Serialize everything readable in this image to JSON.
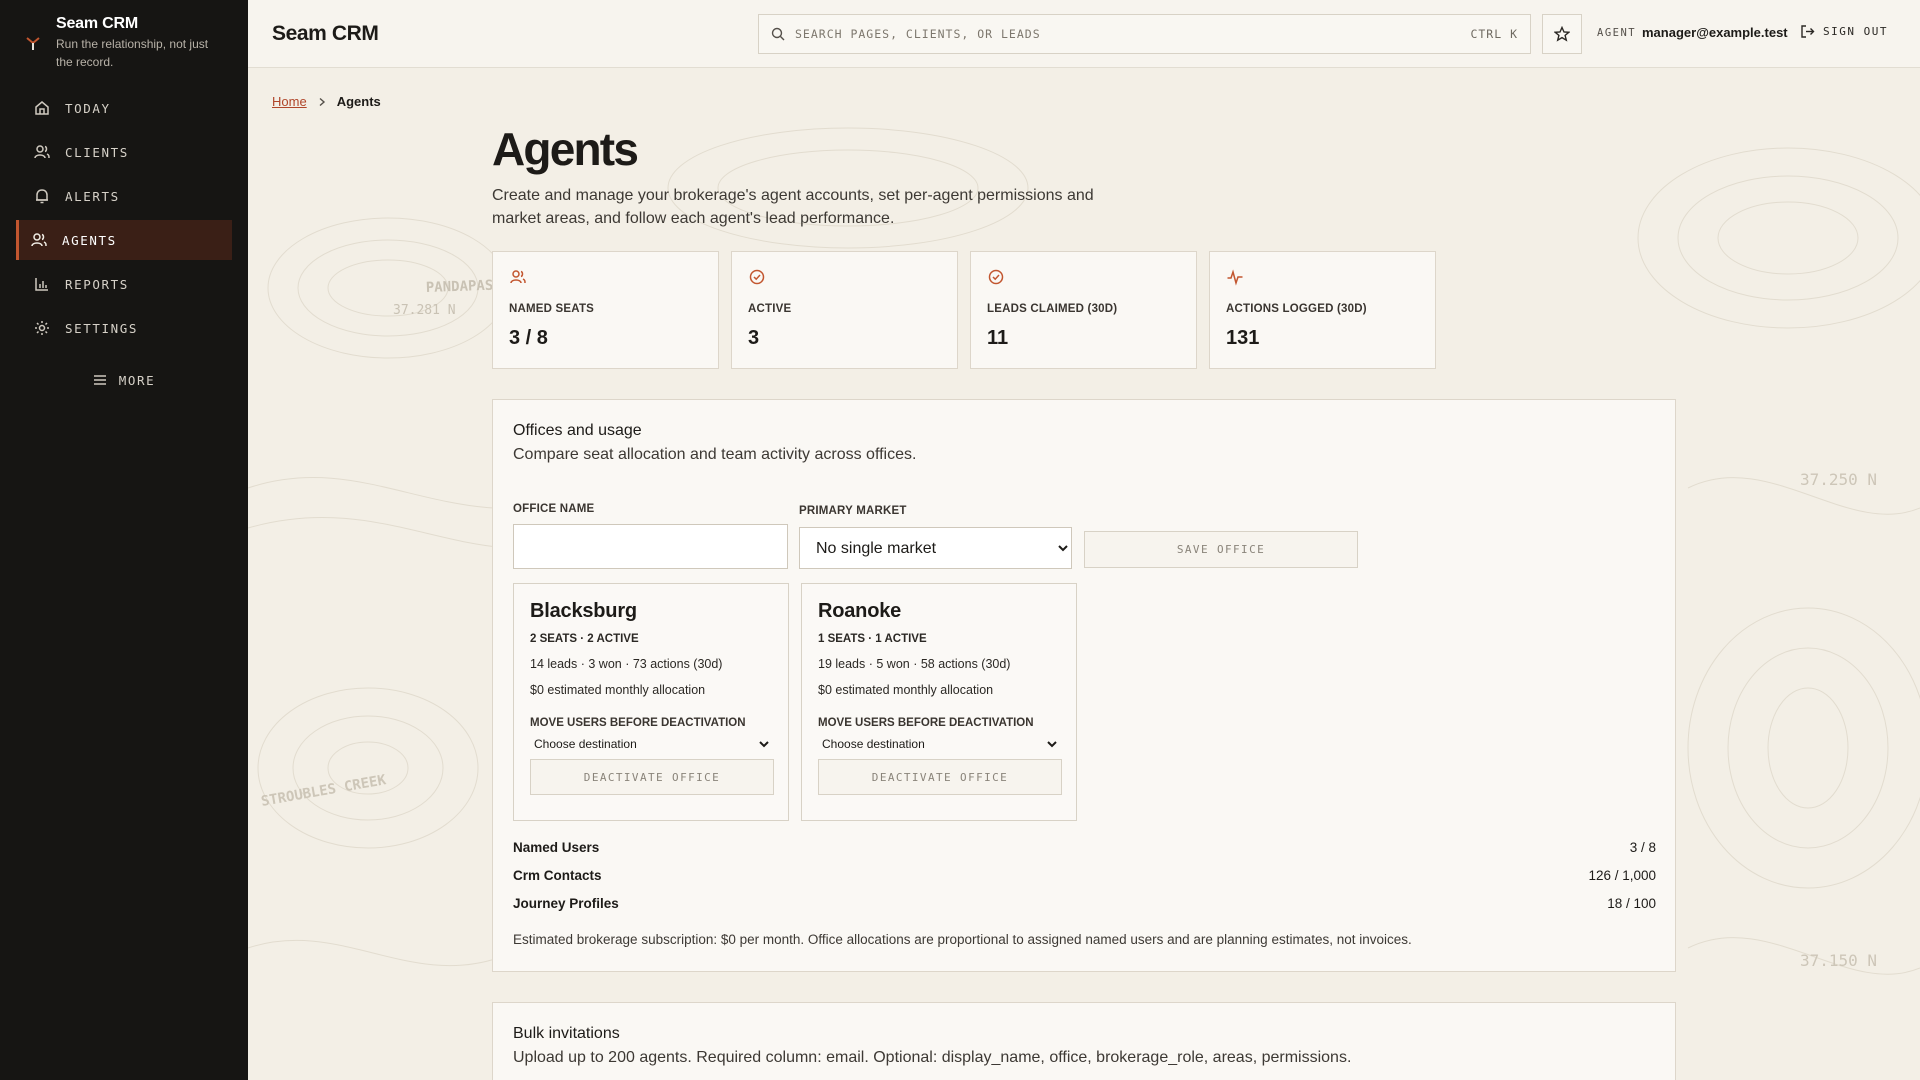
{
  "app": {
    "name": "Seam CRM",
    "tagline": "Run the relationship, not just the record.",
    "accent": "#c2562f"
  },
  "sidebar": {
    "items": [
      {
        "label": "TODAY",
        "icon": "home-icon"
      },
      {
        "label": "CLIENTS",
        "icon": "users-icon"
      },
      {
        "label": "ALERTS",
        "icon": "bell-icon"
      },
      {
        "label": "AGENTS",
        "icon": "users-icon",
        "active": true
      },
      {
        "label": "REPORTS",
        "icon": "bar-chart-icon"
      },
      {
        "label": "SETTINGS",
        "icon": "gear-icon"
      }
    ],
    "more_label": "MORE"
  },
  "topbar": {
    "title": "Seam CRM",
    "search_placeholder": "SEARCH PAGES, CLIENTS, OR LEADS",
    "search_shortcut": "CTRL K",
    "agent_label": "AGENT",
    "agent_email": "manager@example.test",
    "signout_label": "SIGN OUT"
  },
  "breadcrumb": {
    "home": "Home",
    "current": "Agents"
  },
  "page": {
    "title": "Agents",
    "description": "Create and manage your brokerage's agent accounts, set per-agent permissions and market areas, and follow each agent's lead performance."
  },
  "stats": [
    {
      "label": "NAMED SEATS",
      "value": "3 / 8",
      "icon": "users-icon"
    },
    {
      "label": "ACTIVE",
      "value": "3",
      "icon": "check-circle-icon"
    },
    {
      "label": "LEADS CLAIMED (30D)",
      "value": "11",
      "icon": "check-circle-icon"
    },
    {
      "label": "ACTIONS LOGGED (30D)",
      "value": "131",
      "icon": "activity-icon"
    }
  ],
  "offices_panel": {
    "title": "Offices and usage",
    "subtitle": "Compare seat allocation and team activity across offices.",
    "office_name_label": "OFFICE NAME",
    "office_name_value": "",
    "primary_market_label": "PRIMARY MARKET",
    "primary_market_value": "No single market",
    "save_label": "SAVE OFFICE",
    "offices": [
      {
        "name": "Blacksburg",
        "seats": "2 SEATS · 2 ACTIVE",
        "activity": "14 leads · 3 won · 73 actions (30d)",
        "allocation": "$0 estimated monthly allocation",
        "move_label": "MOVE USERS BEFORE DEACTIVATION",
        "destination": "Choose destination",
        "deactivate_label": "DEACTIVATE OFFICE"
      },
      {
        "name": "Roanoke",
        "seats": "1 SEATS · 1 ACTIVE",
        "activity": "19 leads · 5 won · 58 actions (30d)",
        "allocation": "$0 estimated monthly allocation",
        "move_label": "MOVE USERS BEFORE DEACTIVATION",
        "destination": "Choose destination",
        "deactivate_label": "DEACTIVATE OFFICE"
      }
    ],
    "usage": [
      {
        "name": "Named Users",
        "value": "3 / 8"
      },
      {
        "name": "Crm Contacts",
        "value": "126 / 1,000"
      },
      {
        "name": "Journey Profiles",
        "value": "18 / 100"
      }
    ],
    "note": "Estimated brokerage subscription: $0 per month. Office allocations are proportional to assigned named users and are planning estimates, not invoices."
  },
  "bulk_panel": {
    "title": "Bulk invitations",
    "subtitle": "Upload up to 200 agents. Required column: email. Optional: display_name, office, brokerage_role, areas, permissions."
  },
  "map_labels": {
    "pandapas": "PANDAPAS",
    "lat_left": "37.281 N",
    "lat_right_1": "37.250 N",
    "lat_right_2": "37.150 N",
    "creek": "STROUBLES CREEK"
  }
}
